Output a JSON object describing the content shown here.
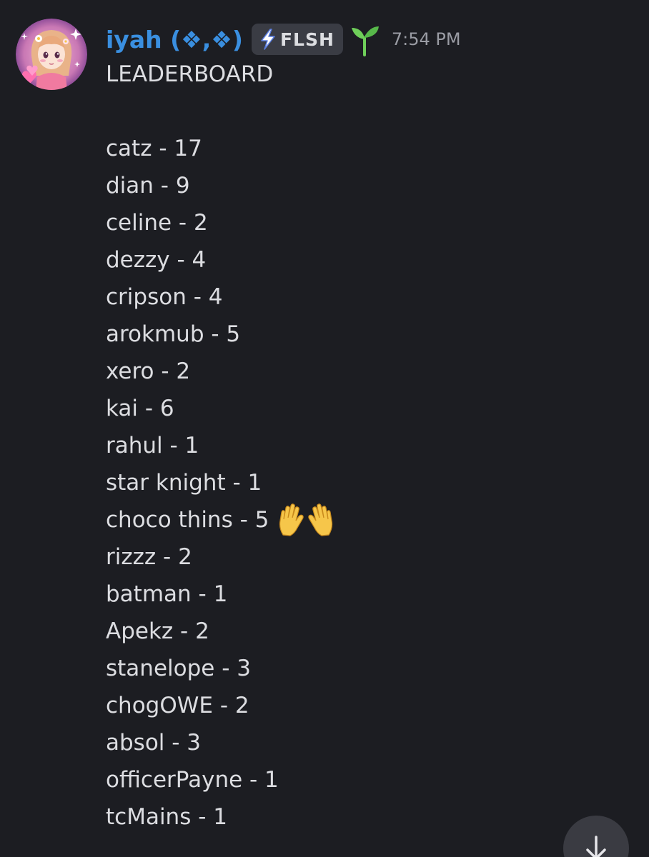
{
  "message": {
    "author": {
      "username": "iyah (❖,❖)",
      "tag": "FLSH",
      "avatar_icon": "anime-girl-avatar",
      "name_color": "#3a8fe0"
    },
    "timestamp": "7:54 PM",
    "title": "LEADERBOARD",
    "leaderboard": [
      {
        "name": "catz",
        "score": "17",
        "text": "catz - 17"
      },
      {
        "name": "dian",
        "score": "9",
        "text": "dian - 9"
      },
      {
        "name": "celine",
        "score": "2",
        "text": "celine - 2"
      },
      {
        "name": "dezzy",
        "score": "4",
        "text": "dezzy - 4"
      },
      {
        "name": "cripson",
        "score": "4",
        "text": "cripson - 4"
      },
      {
        "name": "arokmub",
        "score": "5",
        "text": "arokmub - 5"
      },
      {
        "name": "xero",
        "score": "2",
        "text": "xero - 2"
      },
      {
        "name": "kai",
        "score": "6",
        "text": "kai - 6"
      },
      {
        "name": "rahul",
        "score": "1",
        "text": "rahul - 1"
      },
      {
        "name": "star knight",
        "score": "1",
        "text": "star knight - 1"
      },
      {
        "name": "choco thins",
        "score": "5",
        "text": "choco thins - 5",
        "emoji": "raised-hands-emoji"
      },
      {
        "name": "rizzz",
        "score": "2",
        "text": "rizzz - 2"
      },
      {
        "name": "batman",
        "score": "1",
        "text": "batman - 1"
      },
      {
        "name": "Apekz",
        "score": "2",
        "text": "Apekz - 2"
      },
      {
        "name": "stanelope",
        "score": "3",
        "text": "stanelope - 3"
      },
      {
        "name": "chogOWE",
        "score": "2",
        "text": "chogOWE - 2"
      },
      {
        "name": "absol",
        "score": "3",
        "text": "absol - 3"
      },
      {
        "name": "officerPayne",
        "score": "1",
        "text": "officerPayne - 1"
      },
      {
        "name": "tcMains",
        "score": "1",
        "text": "tcMains - 1"
      }
    ]
  },
  "icons": {
    "tag_icon": "lightning-icon",
    "badge_icon": "sprout-icon",
    "scroll_icon": "arrow-down-icon"
  },
  "colors": {
    "background": "#1c1d22",
    "text": "#dcdde1",
    "timestamp": "#9a9ca4",
    "tag_background": "#3a3c44",
    "scroll_button": "#3a3b42"
  }
}
